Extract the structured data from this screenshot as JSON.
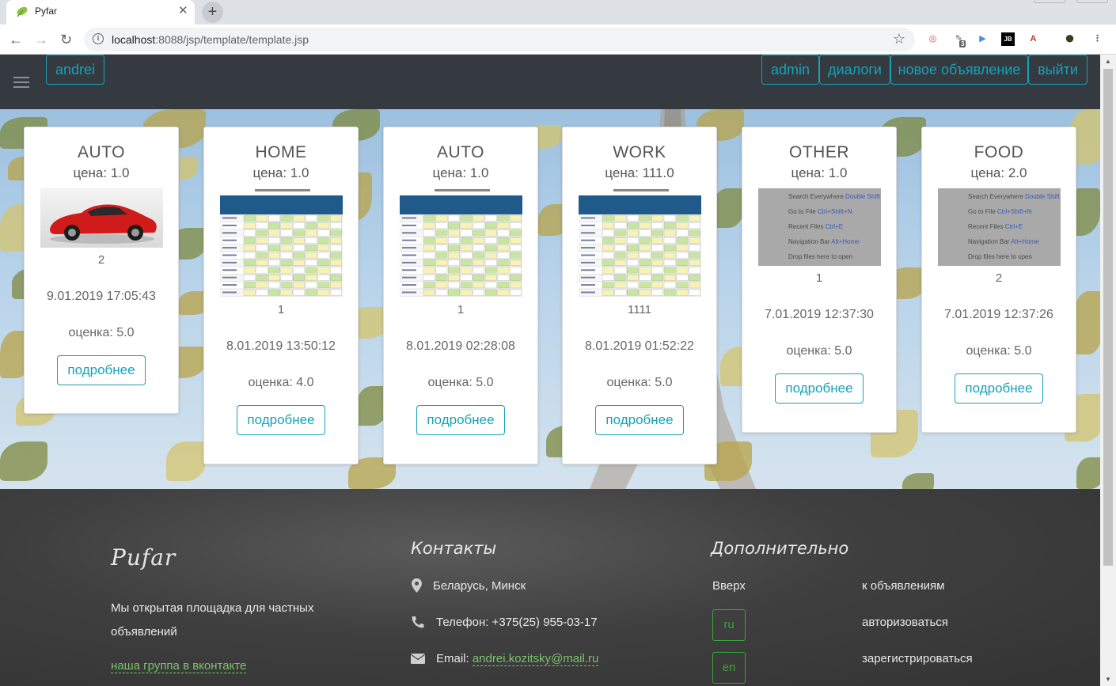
{
  "browser": {
    "tab_title": "Pyfar",
    "tab_close": "✕",
    "new_tab": "+",
    "url_host": "localhost",
    "url_rest": ":8088/jsp/template/template.jsp",
    "back": "←",
    "forward": "→",
    "reload": "↻",
    "star": "☆",
    "extensions": [
      {
        "name": "target-extension-icon",
        "glyph": "◎",
        "color": "#e8453c"
      },
      {
        "name": "badge-extension-icon",
        "glyph": "✎",
        "color": "#5f6368",
        "badge": "3"
      },
      {
        "name": "play-extension-icon",
        "glyph": "▶",
        "color": "#4a90d9"
      },
      {
        "name": "jetbrains-extension-icon",
        "glyph": "JB",
        "color": "#000000"
      },
      {
        "name": "pdf-extension-icon",
        "glyph": "A",
        "color": "#c0392b"
      },
      {
        "name": "profile-avatar-icon",
        "glyph": "●",
        "color": "#3b3b1b"
      },
      {
        "name": "kebab-menu-icon",
        "glyph": "⋮",
        "color": "#5f6368"
      }
    ]
  },
  "navbar": {
    "user": "andrei",
    "buttons": [
      "admin",
      "диалоги",
      "новое объявление",
      "выйти"
    ]
  },
  "cards": [
    {
      "category": "AUTO",
      "price": "цена: 1.0",
      "image": "car",
      "count": "2",
      "date": "9.01.2019 17:05:43",
      "rating": "оценка: 5.0",
      "more": "подробнее"
    },
    {
      "category": "HOME",
      "price": "цена: 1.0",
      "image": "table",
      "count": "1",
      "date": "8.01.2019 13:50:12",
      "rating": "оценка: 4.0",
      "more": "подробнее"
    },
    {
      "category": "AUTO",
      "price": "цена: 1.0",
      "image": "table",
      "count": "1",
      "date": "8.01.2019 02:28:08",
      "rating": "оценка: 5.0",
      "more": "подробнее"
    },
    {
      "category": "WORK",
      "price": "цена: 111.0",
      "image": "table",
      "count": "1111",
      "date": "8.01.2019 01:52:22",
      "rating": "оценка: 5.0",
      "more": "подробнее"
    },
    {
      "category": "OTHER",
      "price": "цена: 1.0",
      "image": "ide",
      "count": "1",
      "date": "7.01.2019 12:37:30",
      "rating": "оценка: 5.0",
      "more": "подробнее"
    },
    {
      "category": "FOOD",
      "price": "цена: 2.0",
      "image": "ide",
      "count": "2",
      "date": "7.01.2019 12:37:26",
      "rating": "оценка: 5.0",
      "more": "подробнее"
    }
  ],
  "ide_lines": [
    [
      "Search Everywhere ",
      "Double Shift"
    ],
    [
      "Go to File ",
      "Ctrl+Shift+N"
    ],
    [
      "Recent Files ",
      "Ctrl+E"
    ],
    [
      "Navigation Bar ",
      "Alt+Home"
    ],
    [
      "Drop files here to open",
      ""
    ]
  ],
  "footer": {
    "brand": "Pufar",
    "about": "Мы открытая площадка для частных объявлений",
    "vk_link": "наша группа в вконтакте",
    "contacts_title": "Контакты",
    "address": "Беларусь, Минск",
    "phone": "Телефон: +375(25) 955-03-17",
    "email_label": "Email: ",
    "email": "andrei.kozitsky@mail.ru",
    "extra_title": "Дополнительно",
    "up": "Вверх",
    "lang_ru": "ru",
    "lang_en": "en",
    "links": [
      "к объявлениям",
      "авторизоваться",
      "зарегистрироваться"
    ]
  },
  "colors": {
    "accent": "#17a2b8",
    "navbar": "#343a40",
    "footer_link": "#7cc36c",
    "lang": "#3aa33a"
  }
}
